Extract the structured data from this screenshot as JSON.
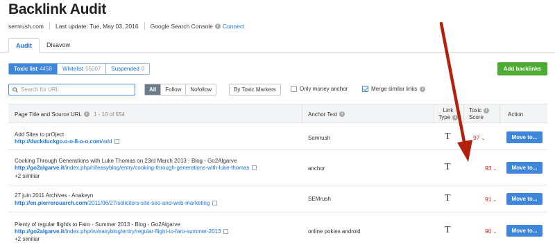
{
  "page": {
    "title": "Backlink Audit"
  },
  "meta": {
    "domain": "semrush.com",
    "last_update": "Last update: Tue, May 03, 2016",
    "gsc_label": "Google Search Console",
    "connect": "Connect"
  },
  "tabs": [
    {
      "label": "Audit",
      "active": true
    },
    {
      "label": "Disavow",
      "active": false
    }
  ],
  "lists": [
    {
      "label": "Toxic list",
      "count": "4458",
      "active": true
    },
    {
      "label": "Whitelist",
      "count": "55007",
      "active": false
    },
    {
      "label": "Suspended",
      "count": "0",
      "active": false
    }
  ],
  "add_backlinks": "Add backlinks",
  "search": {
    "placeholder": "Search for URL",
    "icon": "search-icon"
  },
  "filters": [
    {
      "label": "All",
      "active": true
    },
    {
      "label": "Follow",
      "active": false
    },
    {
      "label": "Nofollow",
      "active": false
    }
  ],
  "toxic_markers": "By Toxic Markers",
  "checkboxes": {
    "only_money": {
      "label": "Only money anchor",
      "checked": false
    },
    "merge": {
      "label": "Merge similar links",
      "checked": true
    }
  },
  "table": {
    "headers": {
      "title": "Page Title and Source URL",
      "range": "1 - 10 of 554",
      "anchor": "Anchor Text",
      "link_type_1": "Link",
      "link_type_2": "Type",
      "toxic_1": "Toxic",
      "toxic_2": "Score",
      "action": "Action"
    },
    "rows": [
      {
        "title": "Add Sites to prOject",
        "url_domain": "http://duckduckgo.o-o-8-o-o.com",
        "url_path": "/add",
        "similar": "",
        "anchor": "Semrush",
        "link_type": "T",
        "score": "97",
        "action": "Move to..."
      },
      {
        "title": "Cooking Through Generations with Luke Thomas on 23rd March 2013 - Blog - Go2Algarve",
        "url_domain": "http://go2algarve.it",
        "url_path": "/index.php/nl/easyblog/entry/cooking-through-generations-with-luke-thomas",
        "similar": "+2 similiar",
        "anchor": "anchor",
        "link_type": "T",
        "score": "93",
        "action": "Move to..."
      },
      {
        "title": "27 juin 2011 Archives - Anakeyn",
        "url_domain": "http://en.pierrerouarch.com",
        "url_path": "/2011/06/27/solicitors-site-seo-and-web-marketing",
        "similar": "",
        "anchor": "SEMrush",
        "link_type": "T",
        "score": "91",
        "action": "Move to..."
      },
      {
        "title": "Plenty of regular flights to Faro - Summer 2013 - Blog - Go2Algarve",
        "url_domain": "http://go2algarve.it",
        "url_path": "/index.php/sv/easyblog/entry/regular-flight-to-faro-summer-2013",
        "similar": "+2 similiar",
        "anchor": "online pokies android",
        "link_type": "T",
        "score": "90",
        "action": "Move to..."
      }
    ]
  },
  "colors": {
    "accent": "#3d86d9",
    "link": "#1a73d9",
    "toxic": "#d9261c",
    "add": "#4cab32",
    "arrow": "#b3200e"
  }
}
